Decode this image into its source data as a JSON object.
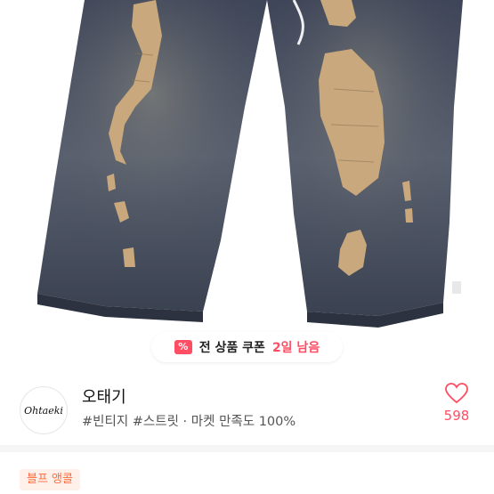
{
  "coupon": {
    "icon": "%",
    "text": "전 상품 쿠폰",
    "days_left": "2일 남음"
  },
  "shop": {
    "logo_text": "Ohtaeki",
    "name": "오태기",
    "tags": "#빈티지 #스트릿 · 마켓 만족도 100%",
    "likes": "598"
  },
  "badge": {
    "label": "블프 앵콜"
  },
  "colors": {
    "accent": "#ff4d64",
    "badge_text": "#ff6b3d",
    "badge_bg": "#fff0e9"
  }
}
